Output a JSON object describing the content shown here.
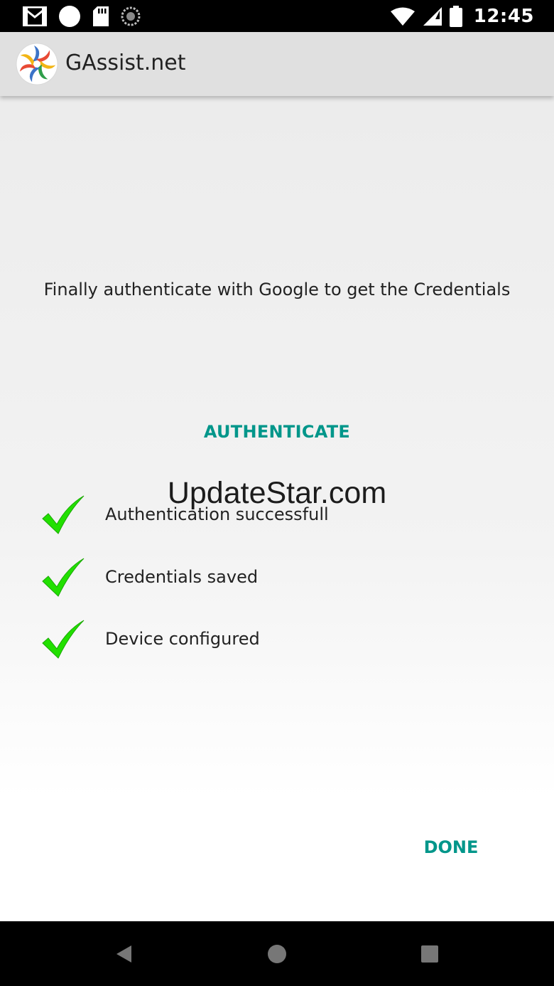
{
  "status_bar": {
    "time": "12:45",
    "icons": [
      "gmail-icon",
      "circle-notification-icon",
      "sd-card-icon",
      "sync-icon",
      "wifi-icon",
      "cell-signal-icon",
      "battery-icon"
    ]
  },
  "app_bar": {
    "title": "GAssist.net",
    "logo_icon": "gassist-logo-icon"
  },
  "content": {
    "instruction": "Finally authenticate with Google to get the Credentials",
    "authenticate_label": "AUTHENTICATE",
    "watermark": "UpdateStar.com",
    "checklist": [
      {
        "label": "Authentication successfull",
        "icon": "check-icon"
      },
      {
        "label": "Credentials saved",
        "icon": "check-icon"
      },
      {
        "label": "Device configured",
        "icon": "check-icon"
      }
    ],
    "done_label": "DONE"
  },
  "nav_bar": {
    "buttons": [
      "back-icon",
      "home-icon",
      "recents-icon"
    ]
  },
  "colors": {
    "accent": "#00968a",
    "check_green": "#22e000",
    "app_bar_bg": "#e0e0e0",
    "status_bar_bg": "#000000"
  }
}
